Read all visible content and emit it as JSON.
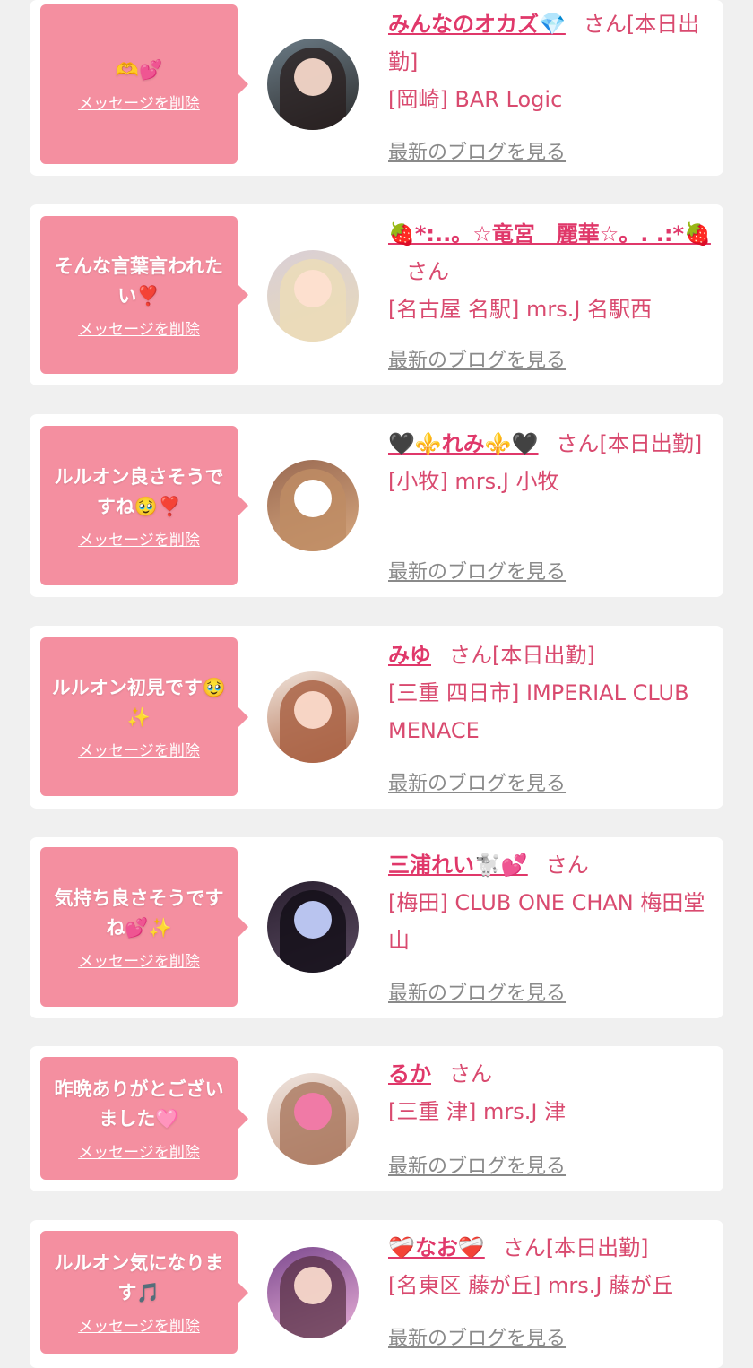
{
  "colors": {
    "background": "#f0f0f0",
    "card": "#ffffff",
    "bubble": "#f48fa0",
    "name": "#e0386a",
    "text": "#d94a6f",
    "blog_link": "#8a8a8a"
  },
  "items": [
    {
      "message": "🫶💕",
      "delete_label": "メッセージを削除",
      "name": "みんなのオカズ💎",
      "suffix": "さん[本日出勤]",
      "location": "[岡崎] BAR Logic",
      "blog_label": "最新のブログを見る",
      "avatar_colors": [
        "#6b7b86",
        "#2b2b2b"
      ]
    },
    {
      "message": "そんな言葉言われたい❣️",
      "delete_label": "メッセージを削除",
      "name": "🍓*:..。☆竜宮　麗華☆。. .:*🍓",
      "suffix": "さん",
      "location": "[名古屋 名駅] mrs.J 名駅西",
      "blog_label": "最新のブログを見る",
      "avatar_colors": [
        "#d9cfd6",
        "#e8d9b8"
      ]
    },
    {
      "message": "ルルオン良さそうですね🥹❣️",
      "delete_label": "メッセージを削除",
      "name": "🖤⚜️れみ⚜️🖤",
      "suffix": "さん[本日出勤]",
      "location": "[小牧] mrs.J 小牧",
      "blog_label": "最新のブログを見る",
      "avatar_colors": [
        "#9a6a52",
        "#d8a980"
      ]
    },
    {
      "message": "ルルオン初見です🥹✨",
      "delete_label": "メッセージを削除",
      "name": "みゆ",
      "suffix": "さん[本日出勤]",
      "location": "[三重 四日市] IMPERIAL CLUB MENACE",
      "blog_label": "最新のブログを見る",
      "avatar_colors": [
        "#efe3da",
        "#b06a4a"
      ]
    },
    {
      "message": "気持ち良さそうですね💕✨",
      "delete_label": "メッセージを削除",
      "name": "三浦れい🐩💕",
      "suffix": "さん",
      "location": "[梅田] CLUB ONE CHAN 梅田堂山",
      "blog_label": "最新のブログを見る",
      "avatar_colors": [
        "#2a2030",
        "#b9c4ef"
      ]
    },
    {
      "message": "昨晩ありがとございました🩷",
      "delete_label": "メッセージを削除",
      "name": "るか",
      "suffix": "さん",
      "location": "[三重 津] mrs.J 津",
      "blog_label": "最新のブログを見る",
      "avatar_colors": [
        "#efe4de",
        "#f07aa6"
      ]
    },
    {
      "message": "ルルオン気になります🎵",
      "delete_label": "メッセージを削除",
      "name": "❤️‍🩹なお❤️‍🩹",
      "suffix": "さん[本日出勤]",
      "location": "[名東区 藤が丘] mrs.J 藤が丘",
      "blog_label": "最新のブログを見る",
      "avatar_colors": [
        "#7d4a8f",
        "#e9b0d8"
      ]
    }
  ]
}
